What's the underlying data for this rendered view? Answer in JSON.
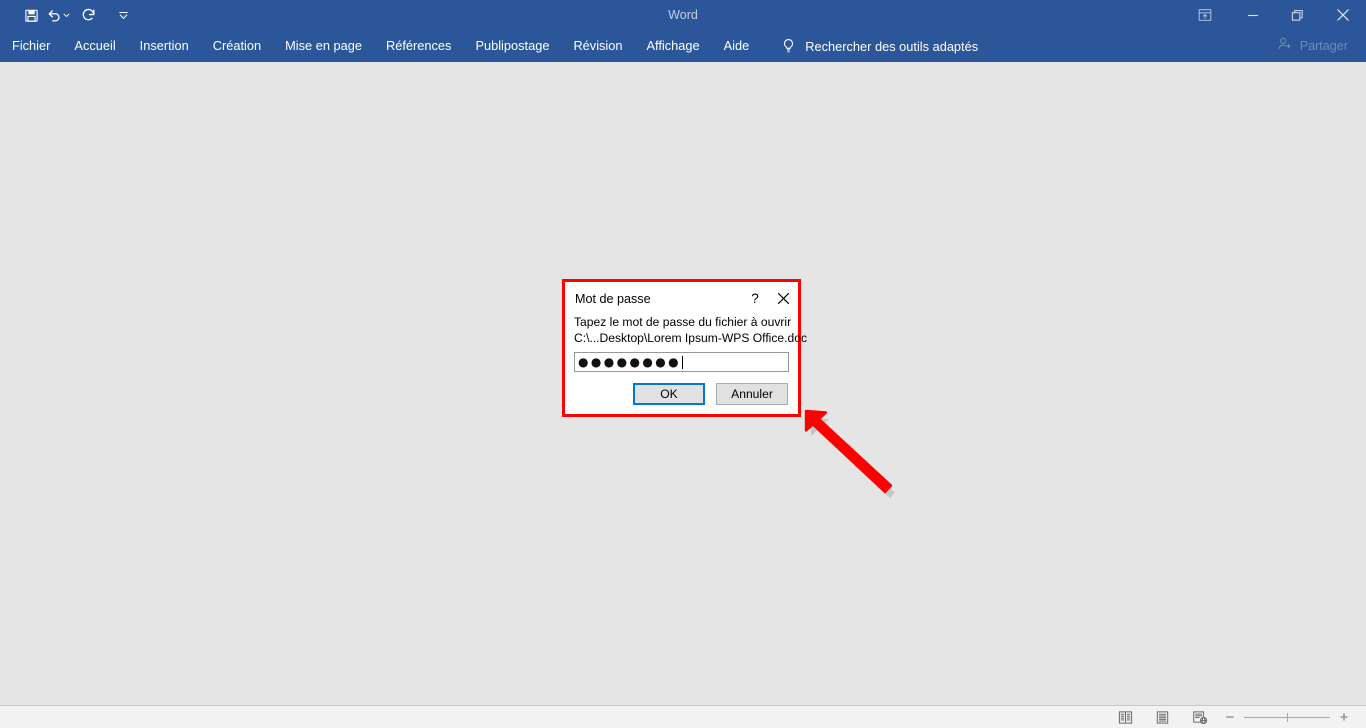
{
  "window": {
    "title": "Word",
    "quick_access": [
      {
        "name": "save",
        "icon": "save-icon",
        "label": "Enregistrer"
      },
      {
        "name": "undo",
        "icon": "undo-icon",
        "label": "Annuler la frappe"
      },
      {
        "name": "redo",
        "icon": "redo-icon",
        "label": "Répéter la frappe"
      },
      {
        "name": "customize",
        "icon": "chevron-down-icon",
        "label": "Personnaliser la barre d'outils Accès rapide"
      }
    ],
    "controls": [
      {
        "name": "ribbon-display-options",
        "icon": "ribbon-options-icon",
        "label": "Options d'affichage du ruban"
      },
      {
        "name": "minimize",
        "icon": "minimize-icon",
        "label": "Réduire"
      },
      {
        "name": "restore",
        "icon": "restore-icon",
        "label": "Agrandir"
      },
      {
        "name": "close",
        "icon": "close-icon",
        "label": "Fermer"
      }
    ]
  },
  "ribbon": {
    "tabs": [
      {
        "label": "Fichier"
      },
      {
        "label": "Accueil"
      },
      {
        "label": "Insertion"
      },
      {
        "label": "Création"
      },
      {
        "label": "Mise en page"
      },
      {
        "label": "Références"
      },
      {
        "label": "Publipostage"
      },
      {
        "label": "Révision"
      },
      {
        "label": "Affichage"
      },
      {
        "label": "Aide"
      }
    ],
    "tell_me": {
      "icon": "lightbulb-icon",
      "placeholder": "Rechercher des outils adaptés"
    },
    "share": {
      "icon": "share-person-icon",
      "label": "Partager"
    }
  },
  "status_bar": {
    "views": [
      {
        "name": "read-mode",
        "icon": "read-mode-icon",
        "label": "Mode Lecture"
      },
      {
        "name": "print-layout",
        "icon": "print-layout-icon",
        "label": "Page"
      },
      {
        "name": "web-layout",
        "icon": "web-layout-icon",
        "label": "Web"
      }
    ],
    "zoom": {
      "minus_label": "−",
      "plus_label": "+"
    }
  },
  "dialog": {
    "title": "Mot de passe",
    "help_label": "?",
    "close_label": "✕",
    "prompt_line1": "Tapez le mot de passe du fichier à ouvrir",
    "prompt_line2": "C:\\...Desktop\\Lorem Ipsum-WPS Office.doc",
    "password_field": {
      "masked_value": "●●●●●●●●",
      "char_count": 8,
      "placeholder": ""
    },
    "buttons": {
      "ok": "OK",
      "cancel": "Annuler"
    },
    "highlight_color": "#fe0000",
    "focus_color": "#0078d7"
  },
  "annotation": {
    "arrow": {
      "name": "red-arrow-pointer",
      "color": "#fe0000",
      "points_to": "dialog-bottom-right"
    }
  },
  "colors": {
    "chrome_blue": "#2b579a",
    "work_area": "#e5e5e5",
    "status_bar": "#f2f2f2"
  }
}
